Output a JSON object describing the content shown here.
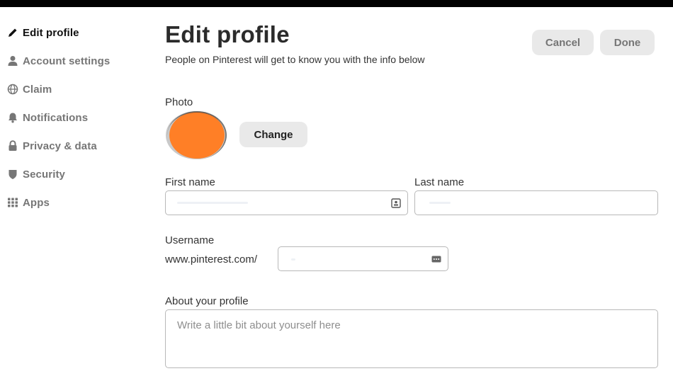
{
  "sidebar": {
    "items": [
      {
        "label": "Edit profile",
        "icon": "pencil-icon",
        "active": true
      },
      {
        "label": "Account settings",
        "icon": "person-icon",
        "active": false
      },
      {
        "label": "Claim",
        "icon": "globe-icon",
        "active": false
      },
      {
        "label": "Notifications",
        "icon": "bell-icon",
        "active": false
      },
      {
        "label": "Privacy & data",
        "icon": "lock-icon",
        "active": false
      },
      {
        "label": "Security",
        "icon": "shield-icon",
        "active": false
      },
      {
        "label": "Apps",
        "icon": "grid-icon",
        "active": false
      }
    ]
  },
  "header": {
    "title": "Edit profile",
    "subtitle": "People on Pinterest will get to know you with the info below",
    "cancel_label": "Cancel",
    "done_label": "Done"
  },
  "photo": {
    "label": "Photo",
    "change_label": "Change",
    "avatar_color": "#ff7f26"
  },
  "form": {
    "first_name_label": "First name",
    "first_name_value": "",
    "last_name_label": "Last name",
    "last_name_value": "",
    "username_label": "Username",
    "username_prefix": "www.pinterest.com/",
    "username_value": "",
    "about_label": "About your profile",
    "about_placeholder": "Write a little bit about yourself here",
    "about_value": ""
  },
  "colors": {
    "button_bg": "#e9e9e9",
    "muted_text": "#767676",
    "active_text": "#111111"
  }
}
